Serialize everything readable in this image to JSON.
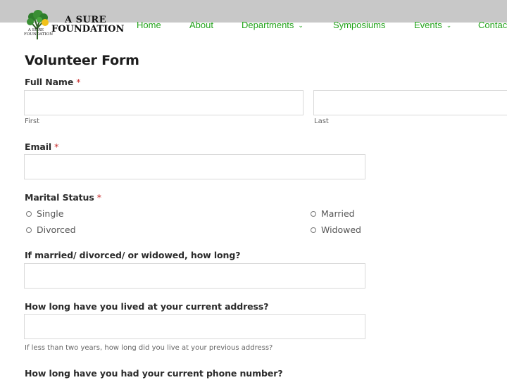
{
  "header": {
    "logo": {
      "line1": "A SURE",
      "line2": "FOUNDATION",
      "small_text": "A SURE FOUNDATION"
    },
    "nav": [
      {
        "label": "Home",
        "has_dropdown": false
      },
      {
        "label": "About",
        "has_dropdown": false
      },
      {
        "label": "Departments",
        "has_dropdown": true
      },
      {
        "label": "Symposiums",
        "has_dropdown": false
      },
      {
        "label": "Events",
        "has_dropdown": true
      },
      {
        "label": "Contac",
        "has_dropdown": false
      }
    ],
    "dropdown_glyph": "⌄",
    "accent_color": "#22a31a"
  },
  "form": {
    "title": "Volunteer Form",
    "required_marker": "*",
    "full_name": {
      "label": "Full Name",
      "first_value": "",
      "last_value": "",
      "first_sublabel": "First",
      "last_sublabel": "Last"
    },
    "email": {
      "label": "Email",
      "value": ""
    },
    "marital_status": {
      "label": "Marital Status",
      "options": [
        "Single",
        "Married",
        "Divorced",
        "Widowed"
      ],
      "selected": null
    },
    "married_how_long": {
      "label": "If married/ divorced/ or widowed, how long?",
      "value": ""
    },
    "current_address": {
      "label": "How long have you lived at your current address?",
      "value": "",
      "help": "If less than two years, how long did you live at your previous address?"
    },
    "phone_duration": {
      "label": "How long have you had your current phone number?"
    }
  }
}
